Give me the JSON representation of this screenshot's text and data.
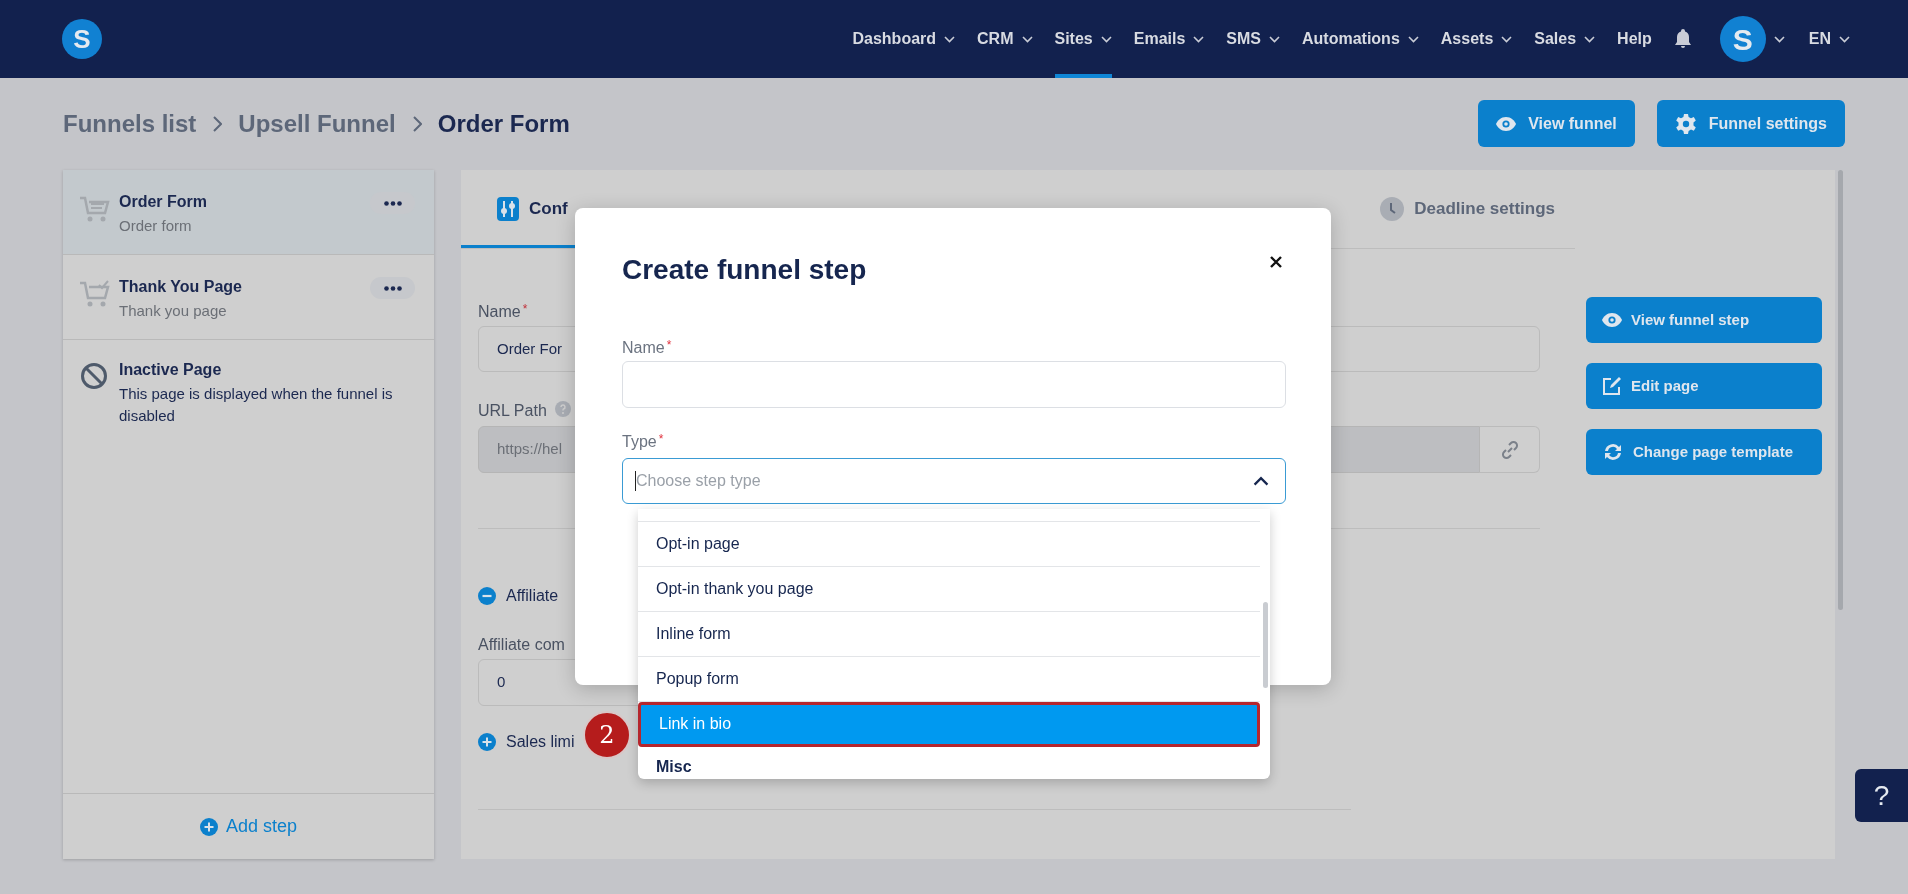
{
  "nav": {
    "logo_letter": "S",
    "items": [
      {
        "label": "Dashboard",
        "dropdown": true,
        "selected": false
      },
      {
        "label": "CRM",
        "dropdown": true,
        "selected": false
      },
      {
        "label": "Sites",
        "dropdown": true,
        "selected": true
      },
      {
        "label": "Emails",
        "dropdown": true,
        "selected": false
      },
      {
        "label": "SMS",
        "dropdown": true,
        "selected": false
      },
      {
        "label": "Automations",
        "dropdown": true,
        "selected": false
      },
      {
        "label": "Assets",
        "dropdown": true,
        "selected": false
      },
      {
        "label": "Sales",
        "dropdown": true,
        "selected": false
      },
      {
        "label": "Help",
        "dropdown": false,
        "selected": false
      }
    ],
    "avatar_letter": "S",
    "language": "EN"
  },
  "breadcrumb": [
    "Funnels list",
    "Upsell Funnel",
    "Order Form"
  ],
  "header_buttons": [
    {
      "label": "View funnel"
    },
    {
      "label": "Funnel settings"
    }
  ],
  "steps": [
    {
      "title": "Order Form",
      "subtitle": "Order form",
      "kind": "cart",
      "selected": true,
      "menu": true
    },
    {
      "title": "Thank You Page",
      "subtitle": "Thank you page",
      "kind": "cart-check",
      "selected": false,
      "menu": true
    },
    {
      "title": "Inactive Page",
      "subtitle": "This page is displayed when the funnel is disabled",
      "kind": "inactive",
      "selected": false,
      "menu": false
    }
  ],
  "add_step": "Add step",
  "tabs": [
    {
      "label": "Conf",
      "kind": "configuration",
      "selected": true
    },
    {
      "label": "Deadline settings",
      "kind": "deadline",
      "selected": false
    }
  ],
  "form": {
    "name": {
      "label": "Name",
      "required_mark": "*",
      "value": "Order For"
    },
    "url": {
      "label": "URL Path",
      "value": "https://hel"
    },
    "sections": [
      {
        "label": "Affiliate",
        "expanded": true,
        "field_label": "Affiliate com",
        "field_value": "0"
      },
      {
        "label": "Sales limi",
        "expanded": false
      }
    ]
  },
  "side_buttons": [
    {
      "label": "View funnel step"
    },
    {
      "label": "Edit page"
    },
    {
      "label": "Change page template"
    }
  ],
  "modal": {
    "title": "Create funnel step",
    "name_field": {
      "label": "Name",
      "required_mark": "*"
    },
    "type_field": {
      "label": "Type",
      "required_mark": "*",
      "placeholder": "Choose step type",
      "expanded": true
    },
    "options": [
      {
        "label": "Opt-in page",
        "selected": false
      },
      {
        "label": "Opt-in thank you page",
        "selected": false
      },
      {
        "label": "Inline form",
        "selected": false
      },
      {
        "label": "Popup form",
        "selected": false
      },
      {
        "label": "Link in bio",
        "selected": true
      }
    ],
    "group_heading": "Misc"
  },
  "annotation": "2",
  "help_button": "?"
}
